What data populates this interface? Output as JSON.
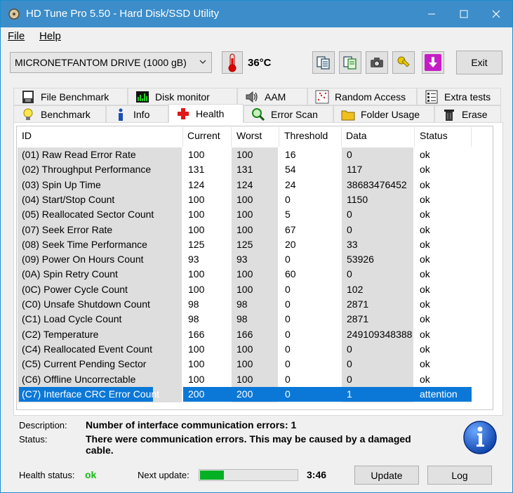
{
  "window": {
    "title": "HD Tune Pro 5.50 - Hard Disk/SSD Utility"
  },
  "menu": {
    "file": "File",
    "help": "Help"
  },
  "toolbar": {
    "drive": "MICRONETFANTOM DRIVE (1000 gB)",
    "temperature": "36°C",
    "exit_label": "Exit"
  },
  "tabs_top": [
    {
      "label": "File Benchmark",
      "icon": "file-benchmark-icon"
    },
    {
      "label": "Disk monitor",
      "icon": "disk-monitor-icon"
    },
    {
      "label": "AAM",
      "icon": "speaker-icon"
    },
    {
      "label": "Random Access",
      "icon": "random-access-icon"
    },
    {
      "label": "Extra tests",
      "icon": "extra-tests-icon"
    }
  ],
  "tabs_bottom": [
    {
      "label": "Benchmark",
      "icon": "lightbulb-icon"
    },
    {
      "label": "Info",
      "icon": "info-icon"
    },
    {
      "label": "Health",
      "icon": "red-cross-icon",
      "active": true
    },
    {
      "label": "Error Scan",
      "icon": "magnifier-icon"
    },
    {
      "label": "Folder Usage",
      "icon": "folder-icon"
    },
    {
      "label": "Erase",
      "icon": "trash-icon"
    }
  ],
  "table": {
    "headers": [
      "ID",
      "Current",
      "Worst",
      "Threshold",
      "Data",
      "Status"
    ],
    "rows": [
      [
        "(01) Raw Read Error Rate",
        "100",
        "100",
        "16",
        "0",
        "ok"
      ],
      [
        "(02) Throughput Performance",
        "131",
        "131",
        "54",
        "117",
        "ok"
      ],
      [
        "(03) Spin Up Time",
        "124",
        "124",
        "24",
        "38683476452",
        "ok"
      ],
      [
        "(04) Start/Stop Count",
        "100",
        "100",
        "0",
        "1150",
        "ok"
      ],
      [
        "(05) Reallocated Sector Count",
        "100",
        "100",
        "5",
        "0",
        "ok"
      ],
      [
        "(07) Seek Error Rate",
        "100",
        "100",
        "67",
        "0",
        "ok"
      ],
      [
        "(08) Seek Time Performance",
        "125",
        "125",
        "20",
        "33",
        "ok"
      ],
      [
        "(09) Power On Hours Count",
        "93",
        "93",
        "0",
        "53926",
        "ok"
      ],
      [
        "(0A) Spin Retry Count",
        "100",
        "100",
        "60",
        "0",
        "ok"
      ],
      [
        "(0C) Power Cycle Count",
        "100",
        "100",
        "0",
        "102",
        "ok"
      ],
      [
        "(C0) Unsafe Shutdown Count",
        "98",
        "98",
        "0",
        "2871",
        "ok"
      ],
      [
        "(C1) Load Cycle Count",
        "98",
        "98",
        "0",
        "2871",
        "ok"
      ],
      [
        "(C2) Temperature",
        "166",
        "166",
        "0",
        "249109348388",
        "ok"
      ],
      [
        "(C4) Reallocated Event Count",
        "100",
        "100",
        "0",
        "0",
        "ok"
      ],
      [
        "(C5) Current Pending Sector",
        "100",
        "100",
        "0",
        "0",
        "ok"
      ],
      [
        "(C6) Offline Uncorrectable",
        "100",
        "100",
        "0",
        "0",
        "ok"
      ],
      [
        "(C7) Interface CRC Error Count",
        "200",
        "200",
        "0",
        "1",
        "attention"
      ]
    ],
    "selected_row": 16
  },
  "details": {
    "description_label": "Description:",
    "description": "Number of interface communication errors: 1",
    "status_label": "Status:",
    "status_line1": "There were communication errors. This may be caused by a damaged",
    "status_line2": "cable."
  },
  "footer": {
    "health_label": "Health status:",
    "health_value": "ok",
    "next_update_label": "Next update:",
    "progress_fraction": 0.24,
    "countdown": "3:46",
    "update_label": "Update",
    "log_label": "Log"
  },
  "colors": {
    "titlebar": "#3c8dc9",
    "selection": "#0b78d7",
    "health_ok": "#18b818",
    "progress": "#06b025"
  }
}
